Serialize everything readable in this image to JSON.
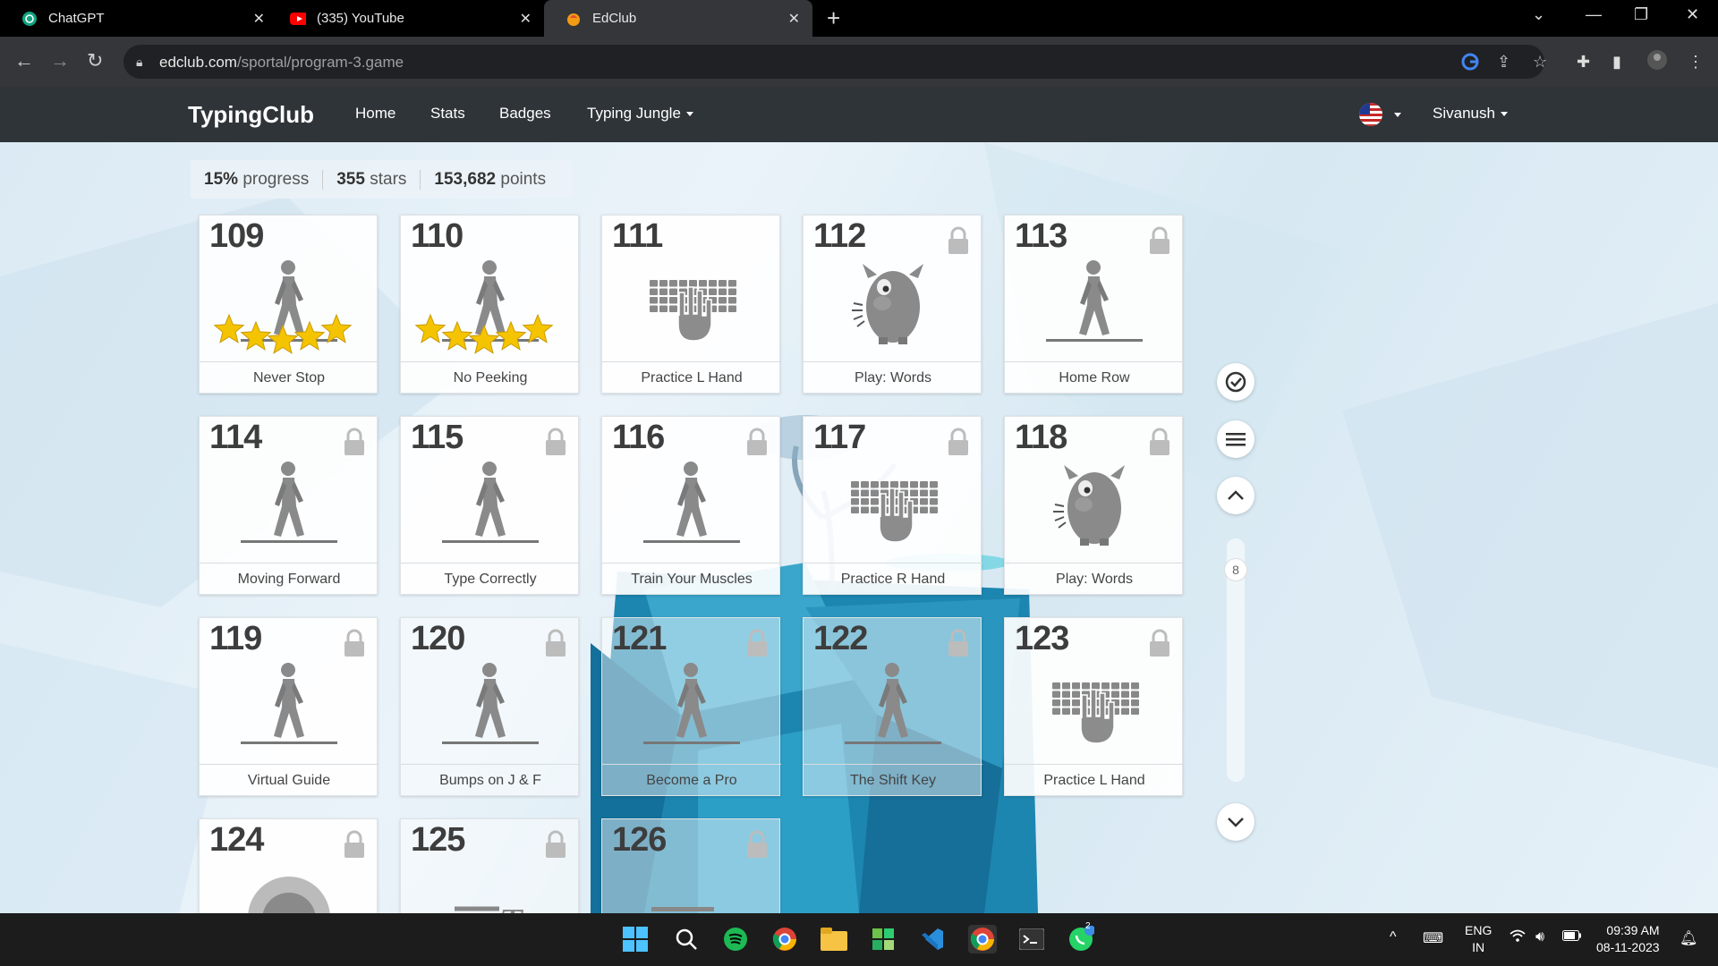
{
  "browser": {
    "tabs": [
      {
        "title": "ChatGPT",
        "icon": "chatgpt-icon"
      },
      {
        "title": "(335) YouTube",
        "icon": "youtube-icon"
      },
      {
        "title": "EdClub",
        "icon": "edclub-icon",
        "active": true
      }
    ],
    "url_host": "edclub.com",
    "url_path": "/sportal/program-3.game"
  },
  "site": {
    "logo": "TypingClub",
    "nav": [
      "Home",
      "Stats",
      "Badges",
      "Typing Jungle"
    ],
    "user": "Sivanush"
  },
  "stats": {
    "progress_value": "15%",
    "progress_label": "progress",
    "stars_value": "355",
    "stars_label": "stars",
    "points_value": "153,682",
    "points_label": "points"
  },
  "lessons": [
    {
      "num": "109",
      "label": "Never Stop",
      "icon": "walker-icon",
      "stars": 5,
      "locked": false
    },
    {
      "num": "110",
      "label": "No Peeking",
      "icon": "walker-icon",
      "stars": 5,
      "locked": false
    },
    {
      "num": "111",
      "label": "Practice L Hand",
      "icon": "keyboard-hand-icon",
      "stars": 0,
      "locked": false
    },
    {
      "num": "112",
      "label": "Play: Words",
      "icon": "monster-icon",
      "stars": 0,
      "locked": true
    },
    {
      "num": "113",
      "label": "Home Row",
      "icon": "walker-icon",
      "stars": 0,
      "locked": true
    },
    {
      "num": "114",
      "label": "Moving Forward",
      "icon": "walker-icon",
      "stars": 0,
      "locked": true
    },
    {
      "num": "115",
      "label": "Type Correctly",
      "icon": "walker-icon",
      "stars": 0,
      "locked": true
    },
    {
      "num": "116",
      "label": "Train Your Muscles",
      "icon": "walker-icon",
      "stars": 0,
      "locked": true
    },
    {
      "num": "117",
      "label": "Practice R Hand",
      "icon": "keyboard-hand-icon",
      "stars": 0,
      "locked": true
    },
    {
      "num": "118",
      "label": "Play: Words",
      "icon": "monster-icon",
      "stars": 0,
      "locked": true
    },
    {
      "num": "119",
      "label": "Virtual Guide",
      "icon": "walker-icon",
      "stars": 0,
      "locked": true
    },
    {
      "num": "120",
      "label": "Bumps on J & F",
      "icon": "walker-icon",
      "stars": 0,
      "locked": true
    },
    {
      "num": "121",
      "label": "Become a Pro",
      "icon": "walker-icon",
      "stars": 0,
      "locked": true
    },
    {
      "num": "122",
      "label": "The Shift Key",
      "icon": "walker-icon",
      "stars": 0,
      "locked": true
    },
    {
      "num": "123",
      "label": "Practice L Hand",
      "icon": "keyboard-hand-icon",
      "stars": 0,
      "locked": true
    },
    {
      "num": "124",
      "label": "",
      "icon": "game-icon",
      "stars": 0,
      "locked": true
    },
    {
      "num": "125",
      "label": "",
      "icon": "speed-icon",
      "stars": 0,
      "locked": true
    },
    {
      "num": "126",
      "label": "",
      "icon": "test-icon",
      "stars": 0,
      "locked": true
    }
  ],
  "side_controls": {
    "page": "8"
  },
  "taskbar": {
    "lang_1": "ENG",
    "lang_2": "IN",
    "time": "09:39 AM",
    "date": "08-11-2023",
    "whatsapp_badge": "2"
  },
  "colors": {
    "star": "#f5c400",
    "header": "#2f3439",
    "iceberg": "#1f8fb8"
  }
}
